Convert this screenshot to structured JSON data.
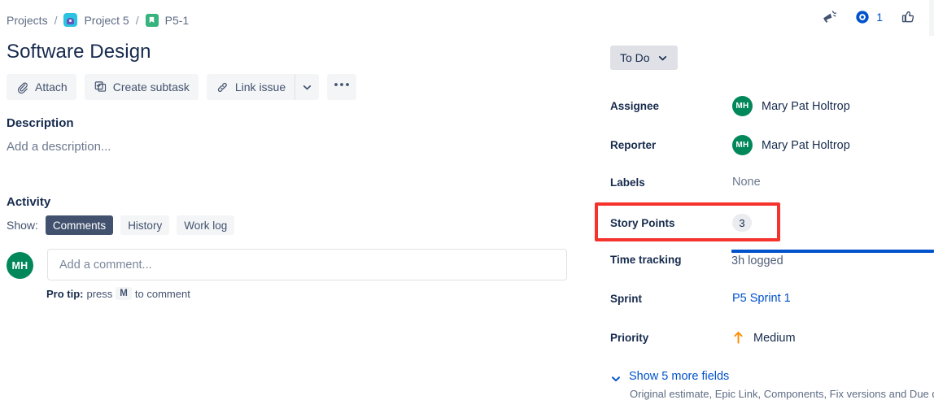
{
  "breadcrumb": {
    "projects_label": "Projects",
    "separator": "/",
    "project_name": "Project 5",
    "issue_key": "P5-1",
    "project_avatar_icon": "project-avatar-icon",
    "issue_type_icon": "story-type-icon"
  },
  "header_actions": {
    "feedback_icon": "megaphone-icon",
    "watch_icon": "eye-icon",
    "watch_count": "1",
    "like_icon": "thumbs-up-icon"
  },
  "issue": {
    "title": "Software Design"
  },
  "toolbar": {
    "attach_label": "Attach",
    "attach_icon": "paperclip-icon",
    "create_subtask_label": "Create subtask",
    "create_subtask_icon": "subtask-icon",
    "link_issue_label": "Link issue",
    "link_issue_icon": "chain-link-icon",
    "caret_icon": "chevron-down-icon",
    "more_label": "•••",
    "more_icon": "ellipsis-icon"
  },
  "description": {
    "heading": "Description",
    "placeholder": "Add a description..."
  },
  "activity": {
    "heading": "Activity",
    "show_label": "Show:",
    "tabs": [
      {
        "label": "Comments",
        "active": true
      },
      {
        "label": "History",
        "active": false
      },
      {
        "label": "Work log",
        "active": false
      }
    ],
    "comment_avatar_initials": "MH",
    "comment_placeholder": "Add a comment...",
    "pro_tip_prefix": "Pro tip:",
    "pro_tip_press": "press",
    "pro_tip_key": "M",
    "pro_tip_suffix": "to comment"
  },
  "details": {
    "status": {
      "label": "To Do",
      "caret_icon": "chevron-down-icon"
    },
    "assignee": {
      "label": "Assignee",
      "initials": "MH",
      "name": "Mary Pat Holtrop"
    },
    "reporter": {
      "label": "Reporter",
      "initials": "MH",
      "name": "Mary Pat Holtrop"
    },
    "labels": {
      "label": "Labels",
      "value": "None"
    },
    "story_points": {
      "label": "Story Points",
      "value": "3"
    },
    "time_tracking": {
      "label": "Time tracking",
      "value": "3h logged",
      "bar_color": "#0052cc"
    },
    "sprint": {
      "label": "Sprint",
      "value": "P5 Sprint 1"
    },
    "priority": {
      "label": "Priority",
      "value": "Medium",
      "icon": "arrow-up-icon",
      "icon_color": "#ff8b00"
    },
    "more_fields": {
      "link": "Show 5 more fields",
      "subtext": "Original estimate, Epic Link, Components, Fix versions and Due date",
      "chevron_icon": "chevron-down-icon"
    }
  },
  "annotation": {
    "color": "#f5322c"
  }
}
